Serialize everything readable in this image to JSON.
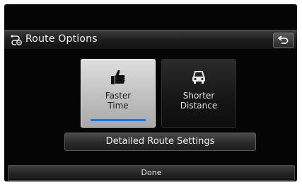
{
  "titlebar": {
    "title": "Route Options",
    "icon": "route-options-icon",
    "back_icon": "back-arrow-icon"
  },
  "options": [
    {
      "label": "Faster\nTime",
      "icon": "thumbs-up-icon",
      "selected": true
    },
    {
      "label": "Shorter\nDistance",
      "icon": "car-icon",
      "selected": false
    }
  ],
  "buttons": {
    "detailed": "Detailed Route Settings",
    "done": "Done"
  },
  "colors": {
    "accent": "#2f6fd0",
    "selected_bg": "#c8c8c8",
    "screen_bg": "#050505"
  }
}
